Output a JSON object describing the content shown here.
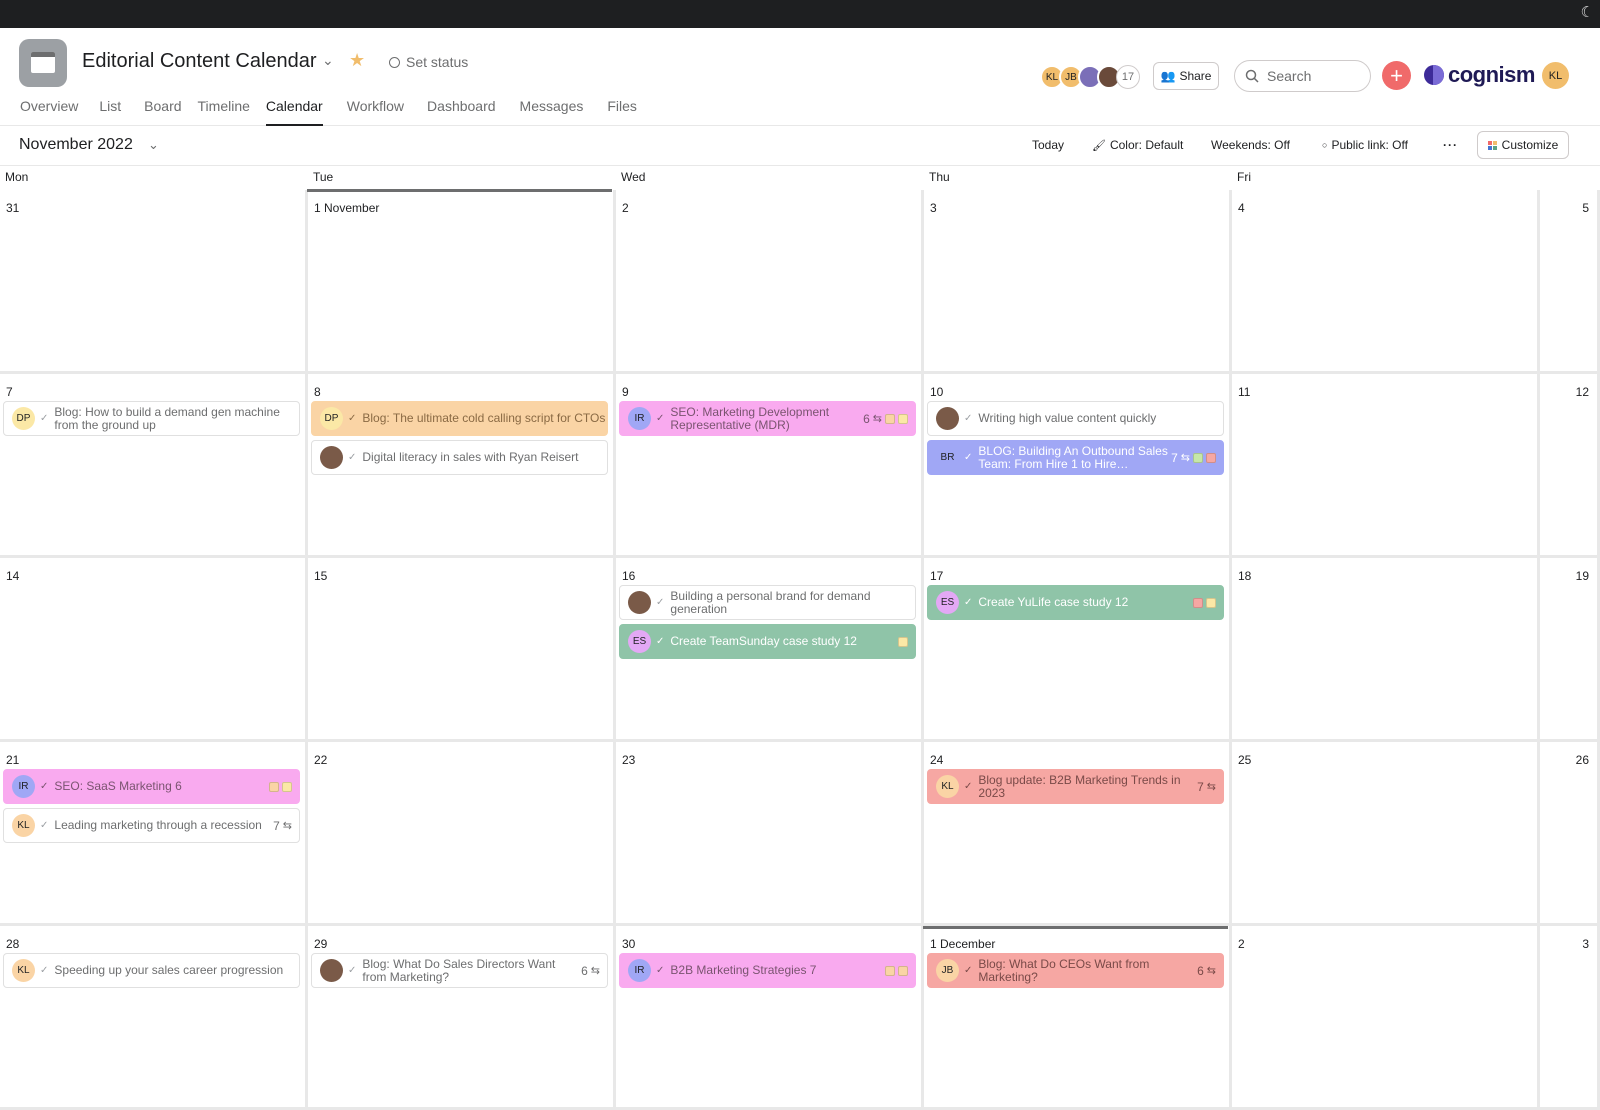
{
  "project": {
    "title": "Editorial Content Calendar",
    "set_status": "Set status"
  },
  "tabs": [
    "Overview",
    "List",
    "Board",
    "Timeline",
    "Calendar",
    "Workflow",
    "Dashboard",
    "Messages",
    "Files"
  ],
  "active_tab": "Calendar",
  "members": {
    "initials": [
      "KL",
      "JB"
    ],
    "count": "17"
  },
  "header": {
    "share_label": "Share",
    "search_placeholder": "Search",
    "brand_name": "cognism",
    "user_initials": "KL"
  },
  "toolbar": {
    "month": "November 2022",
    "today": "Today",
    "color": "Color: Default",
    "weekends": "Weekends: Off",
    "public_link": "Public link: Off",
    "customize": "Customize"
  },
  "weekdays": [
    "Mon",
    "Tue",
    "Wed",
    "Thu",
    "Fri"
  ],
  "weeks": [
    [
      "31",
      "1 November",
      "2",
      "3",
      "4",
      "5"
    ],
    [
      "7",
      "8",
      "9",
      "10",
      "11",
      "12"
    ],
    [
      "14",
      "15",
      "16",
      "17",
      "18",
      "19"
    ],
    [
      "21",
      "22",
      "23",
      "24",
      "25",
      "26"
    ],
    [
      "28",
      "29",
      "30",
      "1 December",
      "2",
      "3"
    ]
  ],
  "tasks": [
    {
      "week": 1,
      "day": 0,
      "slot": 0,
      "avatar": "DP",
      "title": "Blog: How to build a demand gen machine from the ground up",
      "style": "plain",
      "avatar_color": "#fbe8a6"
    },
    {
      "week": 1,
      "day": 1,
      "slot": 0,
      "avatar": "DP",
      "title": "Blog: The ultimate cold calling script for CTOs",
      "style": "peach",
      "avatar_color": "#fbe8a6"
    },
    {
      "week": 1,
      "day": 1,
      "slot": 1,
      "avatar": "",
      "title": "Digital literacy in sales with Ryan Reisert",
      "style": "plain",
      "avatar_color": "photo"
    },
    {
      "week": 1,
      "day": 2,
      "slot": 0,
      "avatar": "IR",
      "title": "SEO: Marketing Development Representative (MDR)",
      "style": "pink",
      "avatar_color": "#a0a7f5",
      "subtasks": "6",
      "tags": [
        "#fad4a5",
        "#fbe8a6"
      ]
    },
    {
      "week": 1,
      "day": 3,
      "slot": 0,
      "avatar": "",
      "title": "Writing high value content quickly",
      "style": "plain",
      "avatar_color": "photo"
    },
    {
      "week": 1,
      "day": 3,
      "slot": 1,
      "avatar": "BR",
      "title": "BLOG: Building An Outbound Sales Team: From Hire 1 to Hire…",
      "style": "purple",
      "avatar_color": "#a0a7f5",
      "subtasks": "7",
      "tags": [
        "#c6e7a8",
        "#f6a7a3"
      ]
    },
    {
      "week": 2,
      "day": 2,
      "slot": 0,
      "avatar": "",
      "title": "Building a personal brand for demand generation",
      "style": "plain",
      "avatar_color": "photo"
    },
    {
      "week": 2,
      "day": 2,
      "slot": 1,
      "avatar": "ES",
      "title": "Create TeamSunday case study 12",
      "style": "green",
      "avatar_color": "#e3a8f5",
      "subtasks": "",
      "tags": [
        "#fbe8a6"
      ]
    },
    {
      "week": 2,
      "day": 3,
      "slot": 0,
      "avatar": "ES",
      "title": "Create YuLife case study 12",
      "style": "green",
      "avatar_color": "#e3a8f5",
      "subtasks": "",
      "tags": [
        "#f6a7a3",
        "#fbe8a6"
      ]
    },
    {
      "week": 3,
      "day": 0,
      "slot": 0,
      "avatar": "IR",
      "title": "SEO: SaaS Marketing 6",
      "style": "pink",
      "avatar_color": "#a0a7f5",
      "subtasks": "",
      "tags": [
        "#fad4a5",
        "#fbe8a6"
      ]
    },
    {
      "week": 3,
      "day": 0,
      "slot": 1,
      "avatar": "KL",
      "title": "Leading marketing through a recession",
      "style": "plain",
      "avatar_color": "#fad4a5",
      "subtasks": "7"
    },
    {
      "week": 3,
      "day": 3,
      "slot": 0,
      "avatar": "KL",
      "title": "Blog update: B2B Marketing Trends in 2023",
      "style": "salmon",
      "avatar_color": "#fad4a5",
      "subtasks": "7"
    },
    {
      "week": 4,
      "day": 0,
      "slot": 0,
      "avatar": "KL",
      "title": "Speeding up your sales career progression",
      "style": "plain",
      "avatar_color": "#fad4a5"
    },
    {
      "week": 4,
      "day": 1,
      "slot": 0,
      "avatar": "",
      "title": "Blog: What Do Sales Directors Want from Marketing?",
      "style": "plain",
      "avatar_color": "photo",
      "subtasks": "6"
    },
    {
      "week": 4,
      "day": 2,
      "slot": 0,
      "avatar": "IR",
      "title": "B2B Marketing Strategies 7",
      "style": "pink",
      "avatar_color": "#a0a7f5",
      "subtasks": "",
      "tags": [
        "#fad4a5",
        "#fad4a5"
      ]
    },
    {
      "week": 4,
      "day": 3,
      "slot": 0,
      "avatar": "JB",
      "title": "Blog: What Do CEOs Want from Marketing?",
      "style": "salmon",
      "avatar_color": "#fad4a5",
      "subtasks": "6"
    }
  ],
  "colors": {
    "accent": "#f06a6a",
    "today_marker": "#6d6e6f",
    "star": "#f1bd6c"
  }
}
